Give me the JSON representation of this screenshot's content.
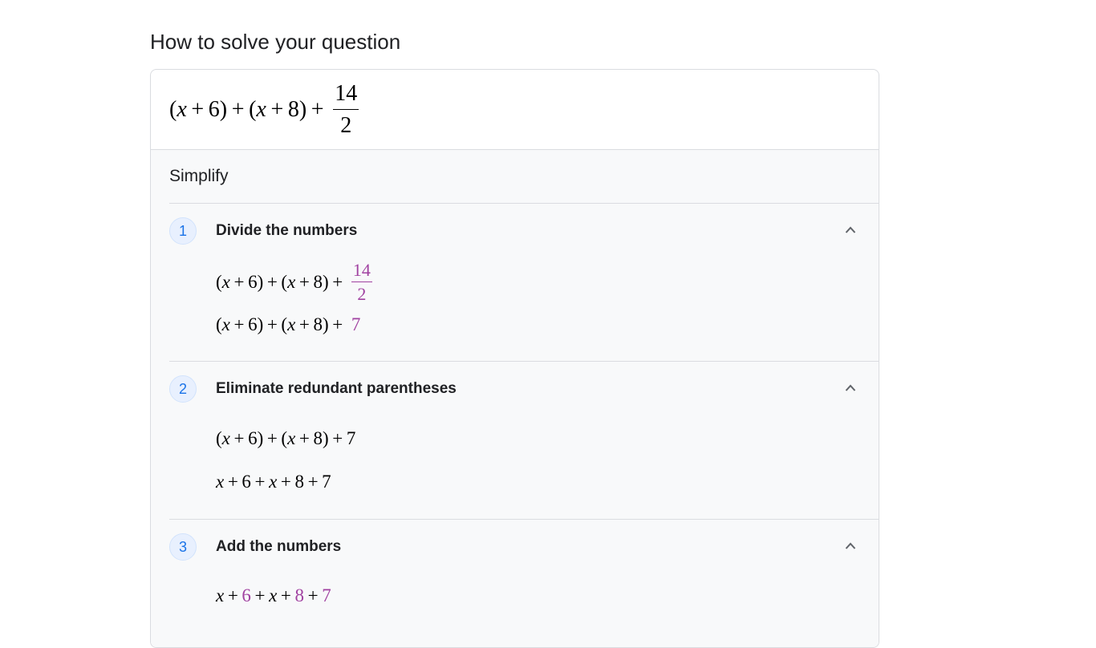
{
  "page": {
    "heading": "How to solve your question"
  },
  "problem": {
    "expr_main": "(x + 6) + (x + 8) + ",
    "frac_num": "14",
    "frac_den": "2"
  },
  "simplify": {
    "label": "Simplify"
  },
  "steps": [
    {
      "number": "1",
      "title": "Divide the numbers",
      "line1_main": "(x + 6) + (x + 8) + ",
      "line1_frac_num": "14",
      "line1_frac_den": "2",
      "line2_main": "(x + 6) + (x + 8) + ",
      "line2_highlight": "7"
    },
    {
      "number": "2",
      "title": "Eliminate redundant parentheses",
      "line1": "(x + 6) + (x + 8) + 7",
      "line2": "x + 6 + x + 8 + 7"
    },
    {
      "number": "3",
      "title": "Add the numbers",
      "line1_parts": [
        "x + ",
        "6",
        " + x + ",
        "8",
        " + ",
        "7"
      ]
    }
  ],
  "colors": {
    "highlight": "#a142a1",
    "badge_text": "#1a73e8",
    "badge_bg": "#e8f0fe",
    "border": "#dadce0",
    "step_bg": "#f8f9fa"
  },
  "icons": {
    "collapse": "chevron-up-icon"
  }
}
